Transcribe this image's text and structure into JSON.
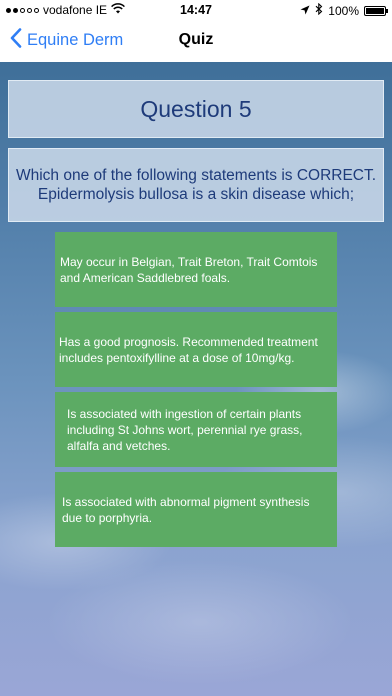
{
  "status_bar": {
    "carrier": "vodafone IE",
    "signal_dots_filled": 2,
    "signal_dots_total": 5,
    "time": "14:47",
    "battery_percent": "100%",
    "battery_level": 1.0,
    "icons": [
      "wifi-icon",
      "location-arrow-icon",
      "bluetooth-icon",
      "battery-icon"
    ]
  },
  "nav": {
    "back_label": "Equine Derm",
    "title": "Quiz",
    "back_icon": "chevron-left-icon"
  },
  "quiz": {
    "question_title": "Question 5",
    "prompt_line1": "Which one of the following statements is CORRECT.",
    "prompt_line2": "Epidermolysis bullosa is a skin disease which;",
    "answers": [
      {
        "text": "May occur in Belgian, Trait Breton, Trait Comtois and American Saddlebred foals."
      },
      {
        "text": "Has a good prognosis. Recommended treatment includes pentoxifylline at a dose of 10mg/kg."
      },
      {
        "text": "Is associated with ingestion of certain plants including St Johns wort, perennial rye grass, alfalfa and vetches."
      },
      {
        "text": "Is associated with abnormal pigment synthesis due to porphyria."
      }
    ]
  },
  "colors": {
    "accent": "#2f7ef5",
    "answer_bg": "#5cab64",
    "question_text": "#1e3b7a"
  }
}
